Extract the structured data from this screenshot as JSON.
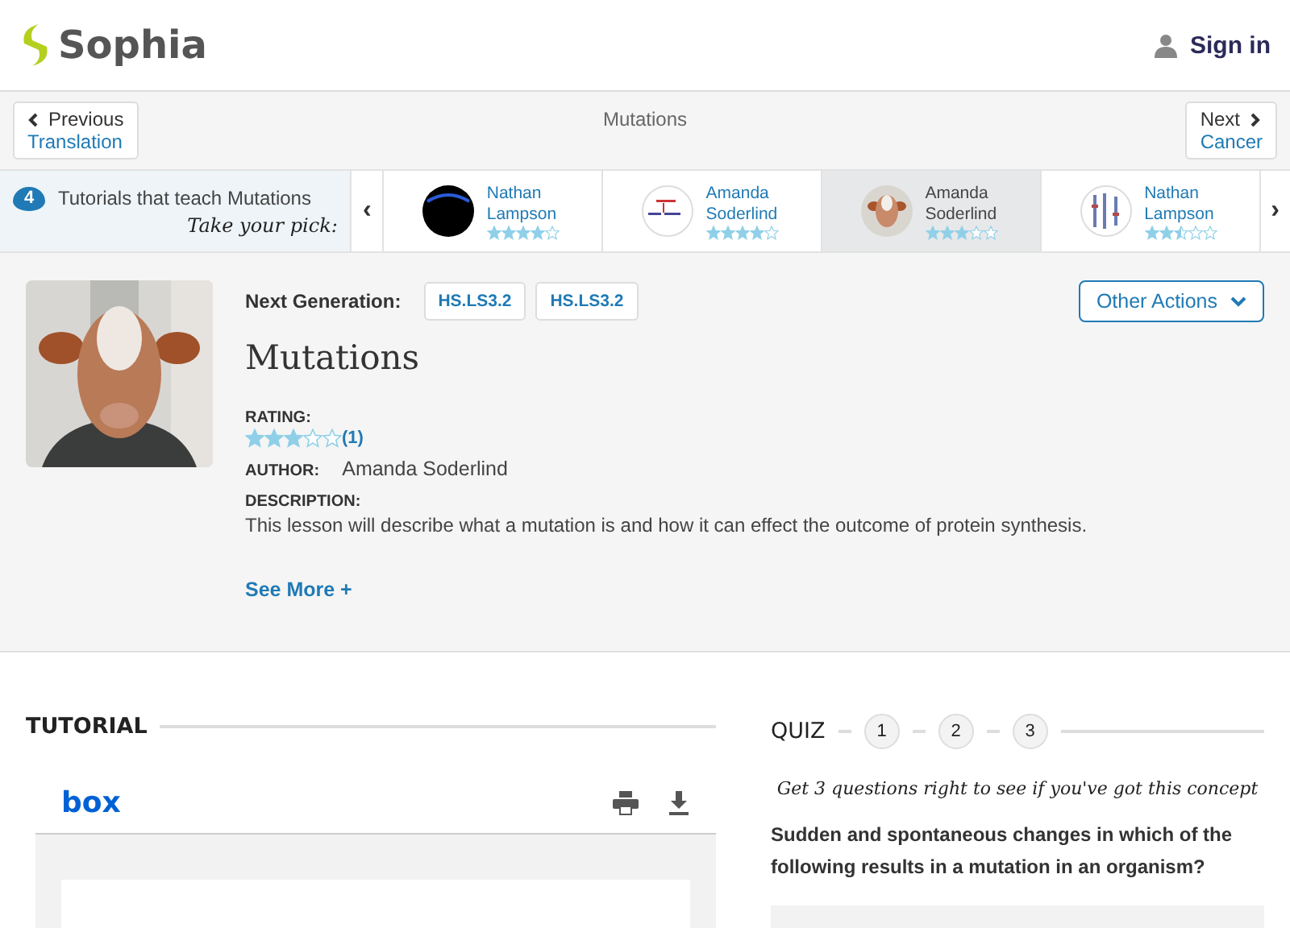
{
  "header": {
    "logo": "Sophia",
    "sign_in": "Sign in"
  },
  "nav": {
    "previous": {
      "label": "Previous",
      "target": "Translation"
    },
    "title": "Mutations",
    "next": {
      "label": "Next",
      "target": "Cancer"
    }
  },
  "tutorials": {
    "count": "4",
    "label": "Tutorials that teach Mutations",
    "tagline": "Take your pick:",
    "prev": "‹",
    "next": "›",
    "items": [
      {
        "author_first": "Nathan",
        "author_last": "Lampson",
        "stars": 4,
        "selected": false
      },
      {
        "author_first": "Amanda",
        "author_last": "Soderlind",
        "stars": 4,
        "selected": false
      },
      {
        "author_first": "Amanda",
        "author_last": "Soderlind",
        "stars": 3,
        "selected": true
      },
      {
        "author_first": "Nathan",
        "author_last": "Lampson",
        "stars": 2.5,
        "selected": false
      }
    ]
  },
  "lesson": {
    "standards_label": "Next Generation:",
    "standards": [
      "HS.LS3.2",
      "HS.LS3.2"
    ],
    "other_actions": "Other Actions",
    "title": "Mutations",
    "rating_label": "RATING:",
    "stars": 3,
    "rating_count": "(1)",
    "author_label": "AUTHOR:",
    "author": "Amanda Soderlind",
    "description_label": "DESCRIPTION:",
    "description": "This lesson will describe what a mutation is and how it can effect the outcome of protein synthesis.",
    "see_more": "See More +"
  },
  "tutorial": {
    "heading": "TUTORIAL",
    "viewer_brand": "box"
  },
  "quiz": {
    "heading": "QUIZ",
    "steps": [
      "1",
      "2",
      "3"
    ],
    "tagline": "Get 3 questions right to see if you've got this concept",
    "question": "Sudden and spontaneous changes in which of the following results in a mutation in an organism?"
  }
}
